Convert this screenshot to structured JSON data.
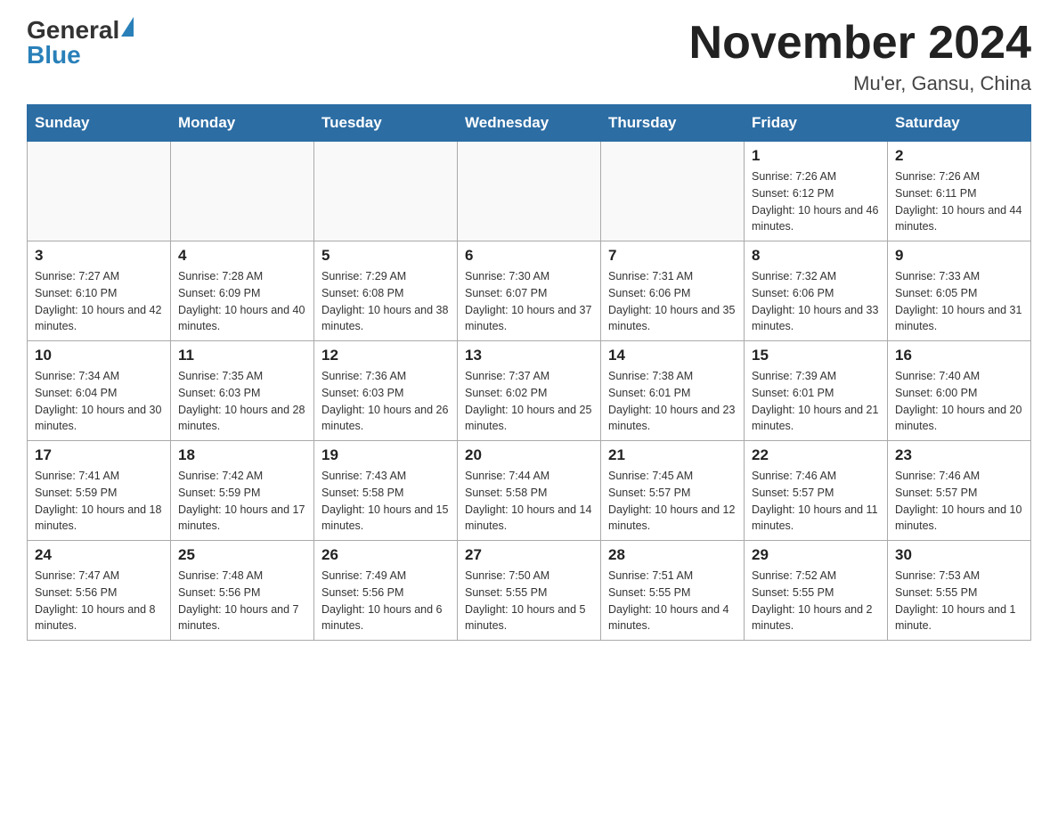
{
  "header": {
    "logo_general": "General",
    "logo_blue": "Blue",
    "title": "November 2024",
    "subtitle": "Mu'er, Gansu, China"
  },
  "days_of_week": [
    "Sunday",
    "Monday",
    "Tuesday",
    "Wednesday",
    "Thursday",
    "Friday",
    "Saturday"
  ],
  "weeks": [
    [
      {
        "day": "",
        "info": ""
      },
      {
        "day": "",
        "info": ""
      },
      {
        "day": "",
        "info": ""
      },
      {
        "day": "",
        "info": ""
      },
      {
        "day": "",
        "info": ""
      },
      {
        "day": "1",
        "info": "Sunrise: 7:26 AM\nSunset: 6:12 PM\nDaylight: 10 hours and 46 minutes."
      },
      {
        "day": "2",
        "info": "Sunrise: 7:26 AM\nSunset: 6:11 PM\nDaylight: 10 hours and 44 minutes."
      }
    ],
    [
      {
        "day": "3",
        "info": "Sunrise: 7:27 AM\nSunset: 6:10 PM\nDaylight: 10 hours and 42 minutes."
      },
      {
        "day": "4",
        "info": "Sunrise: 7:28 AM\nSunset: 6:09 PM\nDaylight: 10 hours and 40 minutes."
      },
      {
        "day": "5",
        "info": "Sunrise: 7:29 AM\nSunset: 6:08 PM\nDaylight: 10 hours and 38 minutes."
      },
      {
        "day": "6",
        "info": "Sunrise: 7:30 AM\nSunset: 6:07 PM\nDaylight: 10 hours and 37 minutes."
      },
      {
        "day": "7",
        "info": "Sunrise: 7:31 AM\nSunset: 6:06 PM\nDaylight: 10 hours and 35 minutes."
      },
      {
        "day": "8",
        "info": "Sunrise: 7:32 AM\nSunset: 6:06 PM\nDaylight: 10 hours and 33 minutes."
      },
      {
        "day": "9",
        "info": "Sunrise: 7:33 AM\nSunset: 6:05 PM\nDaylight: 10 hours and 31 minutes."
      }
    ],
    [
      {
        "day": "10",
        "info": "Sunrise: 7:34 AM\nSunset: 6:04 PM\nDaylight: 10 hours and 30 minutes."
      },
      {
        "day": "11",
        "info": "Sunrise: 7:35 AM\nSunset: 6:03 PM\nDaylight: 10 hours and 28 minutes."
      },
      {
        "day": "12",
        "info": "Sunrise: 7:36 AM\nSunset: 6:03 PM\nDaylight: 10 hours and 26 minutes."
      },
      {
        "day": "13",
        "info": "Sunrise: 7:37 AM\nSunset: 6:02 PM\nDaylight: 10 hours and 25 minutes."
      },
      {
        "day": "14",
        "info": "Sunrise: 7:38 AM\nSunset: 6:01 PM\nDaylight: 10 hours and 23 minutes."
      },
      {
        "day": "15",
        "info": "Sunrise: 7:39 AM\nSunset: 6:01 PM\nDaylight: 10 hours and 21 minutes."
      },
      {
        "day": "16",
        "info": "Sunrise: 7:40 AM\nSunset: 6:00 PM\nDaylight: 10 hours and 20 minutes."
      }
    ],
    [
      {
        "day": "17",
        "info": "Sunrise: 7:41 AM\nSunset: 5:59 PM\nDaylight: 10 hours and 18 minutes."
      },
      {
        "day": "18",
        "info": "Sunrise: 7:42 AM\nSunset: 5:59 PM\nDaylight: 10 hours and 17 minutes."
      },
      {
        "day": "19",
        "info": "Sunrise: 7:43 AM\nSunset: 5:58 PM\nDaylight: 10 hours and 15 minutes."
      },
      {
        "day": "20",
        "info": "Sunrise: 7:44 AM\nSunset: 5:58 PM\nDaylight: 10 hours and 14 minutes."
      },
      {
        "day": "21",
        "info": "Sunrise: 7:45 AM\nSunset: 5:57 PM\nDaylight: 10 hours and 12 minutes."
      },
      {
        "day": "22",
        "info": "Sunrise: 7:46 AM\nSunset: 5:57 PM\nDaylight: 10 hours and 11 minutes."
      },
      {
        "day": "23",
        "info": "Sunrise: 7:46 AM\nSunset: 5:57 PM\nDaylight: 10 hours and 10 minutes."
      }
    ],
    [
      {
        "day": "24",
        "info": "Sunrise: 7:47 AM\nSunset: 5:56 PM\nDaylight: 10 hours and 8 minutes."
      },
      {
        "day": "25",
        "info": "Sunrise: 7:48 AM\nSunset: 5:56 PM\nDaylight: 10 hours and 7 minutes."
      },
      {
        "day": "26",
        "info": "Sunrise: 7:49 AM\nSunset: 5:56 PM\nDaylight: 10 hours and 6 minutes."
      },
      {
        "day": "27",
        "info": "Sunrise: 7:50 AM\nSunset: 5:55 PM\nDaylight: 10 hours and 5 minutes."
      },
      {
        "day": "28",
        "info": "Sunrise: 7:51 AM\nSunset: 5:55 PM\nDaylight: 10 hours and 4 minutes."
      },
      {
        "day": "29",
        "info": "Sunrise: 7:52 AM\nSunset: 5:55 PM\nDaylight: 10 hours and 2 minutes."
      },
      {
        "day": "30",
        "info": "Sunrise: 7:53 AM\nSunset: 5:55 PM\nDaylight: 10 hours and 1 minute."
      }
    ]
  ]
}
